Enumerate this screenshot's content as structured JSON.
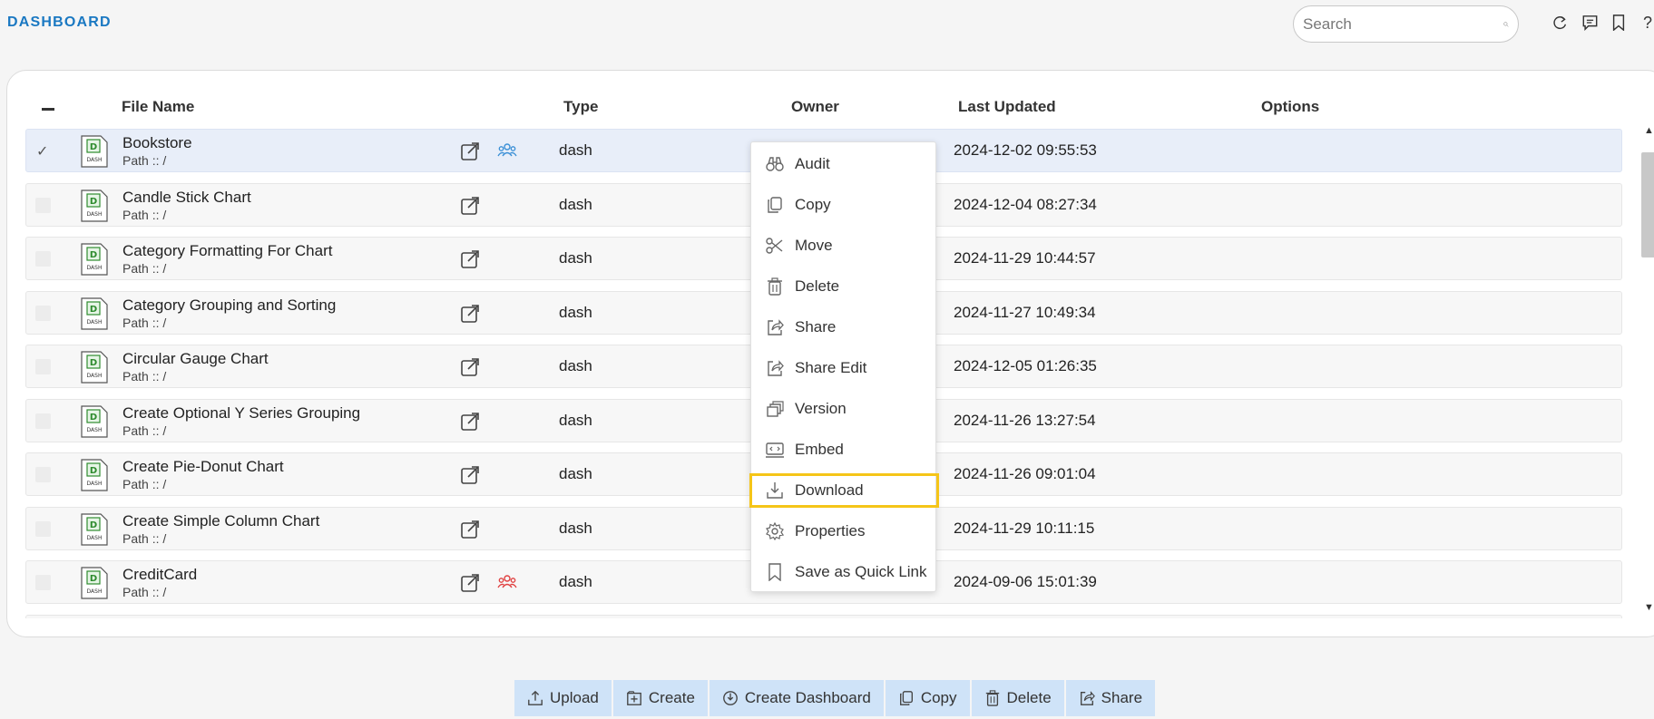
{
  "header": {
    "app_title": "DASHBOARD",
    "search_placeholder": "Search",
    "icons": [
      "refresh-icon",
      "comment-icon",
      "bookmark-icon",
      "help-icon"
    ],
    "help_glyph": "?"
  },
  "table": {
    "columns": {
      "file_name": "File Name",
      "type": "Type",
      "owner": "Owner",
      "last_updated": "Last Updated",
      "options": "Options"
    },
    "rows": [
      {
        "name": "Bookstore",
        "path": "Path :: /",
        "type": "dash",
        "updated": "2024-12-02 09:55:53",
        "selected": true,
        "shared": "blue"
      },
      {
        "name": "Candle Stick Chart",
        "path": "Path :: /",
        "type": "dash",
        "updated": "2024-12-04 08:27:34"
      },
      {
        "name": "Category Formatting For Chart",
        "path": "Path :: /",
        "type": "dash",
        "updated": "2024-11-29 10:44:57"
      },
      {
        "name": "Category Grouping and Sorting",
        "path": "Path :: /",
        "type": "dash",
        "updated": "2024-11-27 10:49:34"
      },
      {
        "name": "Circular Gauge Chart",
        "path": "Path :: /",
        "type": "dash",
        "updated": "2024-12-05 01:26:35"
      },
      {
        "name": "Create Optional Y Series Grouping",
        "path": "Path :: /",
        "type": "dash",
        "updated": "2024-11-26 13:27:54"
      },
      {
        "name": "Create Pie-Donut Chart",
        "path": "Path :: /",
        "type": "dash",
        "updated": "2024-11-26 09:01:04"
      },
      {
        "name": "Create Simple Column Chart",
        "path": "Path :: /",
        "type": "dash",
        "updated": "2024-11-29 10:11:15"
      },
      {
        "name": "CreditCard",
        "path": "Path :: /",
        "type": "dash",
        "updated": "2024-09-06 15:01:39",
        "shared": "red"
      }
    ]
  },
  "context_menu": {
    "items": [
      {
        "label": "Audit",
        "icon": "binoculars-icon"
      },
      {
        "label": "Copy",
        "icon": "copy-icon"
      },
      {
        "label": "Move",
        "icon": "scissors-icon"
      },
      {
        "label": "Delete",
        "icon": "trash-icon"
      },
      {
        "label": "Share",
        "icon": "share-icon"
      },
      {
        "label": "Share Edit",
        "icon": "share-edit-icon"
      },
      {
        "label": "Version",
        "icon": "version-icon"
      },
      {
        "label": "Embed",
        "icon": "embed-icon"
      },
      {
        "label": "Download",
        "icon": "download-icon",
        "highlighted": true
      },
      {
        "label": "Properties",
        "icon": "gear-icon"
      },
      {
        "label": "Save as Quick Link",
        "icon": "bookmark-icon"
      }
    ]
  },
  "toolbar": {
    "buttons": [
      {
        "label": "Upload",
        "icon": "upload-icon"
      },
      {
        "label": "Create",
        "icon": "create-icon"
      },
      {
        "label": "Create Dashboard",
        "icon": "dashboard-icon"
      },
      {
        "label": "Copy",
        "icon": "copy-icon"
      },
      {
        "label": "Delete",
        "icon": "trash-icon"
      },
      {
        "label": "Share",
        "icon": "share-icon"
      }
    ]
  },
  "colors": {
    "accent": "#1a78c2",
    "selected_row": "#e8eef9",
    "toolbar_button": "#cfe3f8",
    "highlight_border": "#f5c518",
    "shared_blue": "#3a8fd6",
    "shared_red": "#e04040"
  }
}
